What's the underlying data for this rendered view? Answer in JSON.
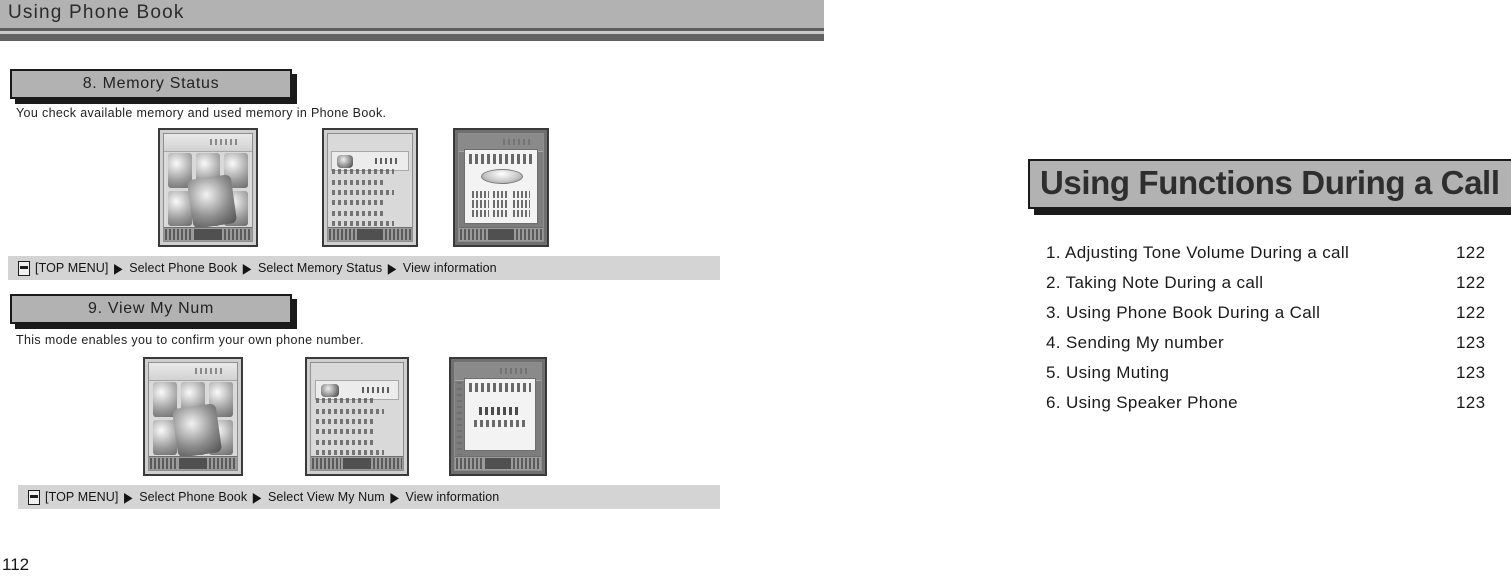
{
  "left_page": {
    "header": {
      "title": "Using Phone Book"
    },
    "page_number": "112",
    "sections": [
      {
        "plaque_label": "8. Memory Status",
        "description": "You check available memory and used memory in Phone Book.",
        "screens": [
          {
            "name": "main-menu-screen",
            "variant": "grid"
          },
          {
            "name": "phone-book-menu-screen",
            "variant": "list"
          },
          {
            "name": "memory-status-screen",
            "variant": "dialog-disc"
          }
        ],
        "nav_path": {
          "icon": "menu-book-icon",
          "start": "[TOP MENU]",
          "steps": [
            "Select Phone Book",
            "Select Memory Status",
            "View information"
          ],
          "arrow": "▶"
        }
      },
      {
        "plaque_label": "9. View My Num",
        "description": "This mode enables you to confirm your own phone number.",
        "screens": [
          {
            "name": "main-menu-screen",
            "variant": "grid"
          },
          {
            "name": "phone-book-menu-screen",
            "variant": "list"
          },
          {
            "name": "view-my-num-screen",
            "variant": "dialog-text"
          }
        ],
        "nav_path": {
          "icon": "menu-book-icon",
          "start": "[TOP MENU]",
          "steps": [
            "Select Phone Book",
            "Select View My Num",
            "View information"
          ],
          "arrow": "▶"
        }
      }
    ]
  },
  "right_page": {
    "chapter_title": "Using Functions During a Call",
    "toc": [
      {
        "label": "1. Adjusting Tone Volume During a call",
        "page": "122"
      },
      {
        "label": "2. Taking Note During a call",
        "page": "122"
      },
      {
        "label": "3. Using Phone Book During a Call",
        "page": "122"
      },
      {
        "label": "4. Sending My number",
        "page": "123"
      },
      {
        "label": "5. Using Muting",
        "page": "123"
      },
      {
        "label": "6. Using Speaker Phone",
        "page": "123"
      }
    ]
  },
  "colors": {
    "plaque_fill": "#b2b2b2",
    "plaque_border": "#1a1a1a",
    "nav_bar_fill": "#d4d4d4",
    "header_fill": "#b2b2b2",
    "page_bg": "#ffffff"
  }
}
